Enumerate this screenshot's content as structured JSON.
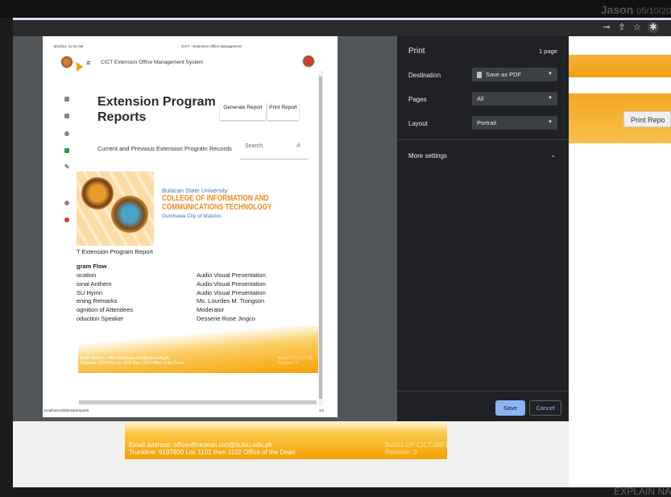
{
  "background": {
    "user_name": "Jason",
    "user_date": "05/10/20",
    "print_report_button": "Print Repo",
    "banner_email": "Email address: officeofthedean.cict@bulsu.edu.ph",
    "banner_trunkline": "Trunkline: 9197800 Loc 1101 then 1102 Office of the Dean",
    "banner_code": "BulSU-OP-CICT-08F1",
    "banner_revision": "Revision: 0",
    "explain_text": "EXPLAIN NA"
  },
  "preview": {
    "print_timestamp": "5/10/23, 11:44 AM",
    "doc_title": "CICT - Extension Office Management",
    "footer_url": "localhost:4200/main/reports",
    "footer_page": "1/1",
    "app_title": "CICT Extension Office Management System",
    "page_title": "Extension Program Reports",
    "generate_button": "Generate Report",
    "print_button": "Print Report",
    "records_label": "Current and Previous Extension Program Records",
    "search_placeholder": "Search",
    "university": "Bulacan State University",
    "college_line1": "COLLEGE OF INFORMATION AND",
    "college_line2": "COMMUNICATIONS TECHNOLOGY",
    "location": "Guinhawa City of Malolos",
    "report_name": "T Extension Program Report",
    "flow_heading": "gram Flow",
    "flow": [
      {
        "item": "ocation",
        "detail": "Audio Visual Presentation"
      },
      {
        "item": "ional Anthem",
        "detail": "Audio Visual Presentation"
      },
      {
        "item": "SU Hymn",
        "detail": "Audio Visual Presentation"
      },
      {
        "item": "ening Remarks",
        "detail": "Ms. Lourdes M. Tiongson"
      },
      {
        "item": "ognition of Attendees",
        "detail": "Moderator"
      },
      {
        "item": "oduction Speaker",
        "detail": "Desserie Rose Jingco"
      }
    ],
    "paper_email": "Email address: officeofthedean.cict@bulsu.edu.ph",
    "paper_trunkline": "Trunkline: 9197800 Loc 1101 then 1102 Office of the Dean",
    "paper_code": "BulSU-OP-CICT-08",
    "paper_revision": "Revision: 0"
  },
  "print_panel": {
    "title": "Print",
    "page_count": "1 page",
    "destination_label": "Destination",
    "destination_value": "Save as PDF",
    "pages_label": "Pages",
    "pages_value": "All",
    "layout_label": "Layout",
    "layout_value": "Portrait",
    "more_settings": "More settings",
    "save_button": "Save",
    "cancel_button": "Cancel"
  },
  "colors": {
    "accent": "#8ab4f8",
    "panel_bg": "#202124",
    "orange": "#f5a000",
    "college_orange": "#f0891b"
  }
}
